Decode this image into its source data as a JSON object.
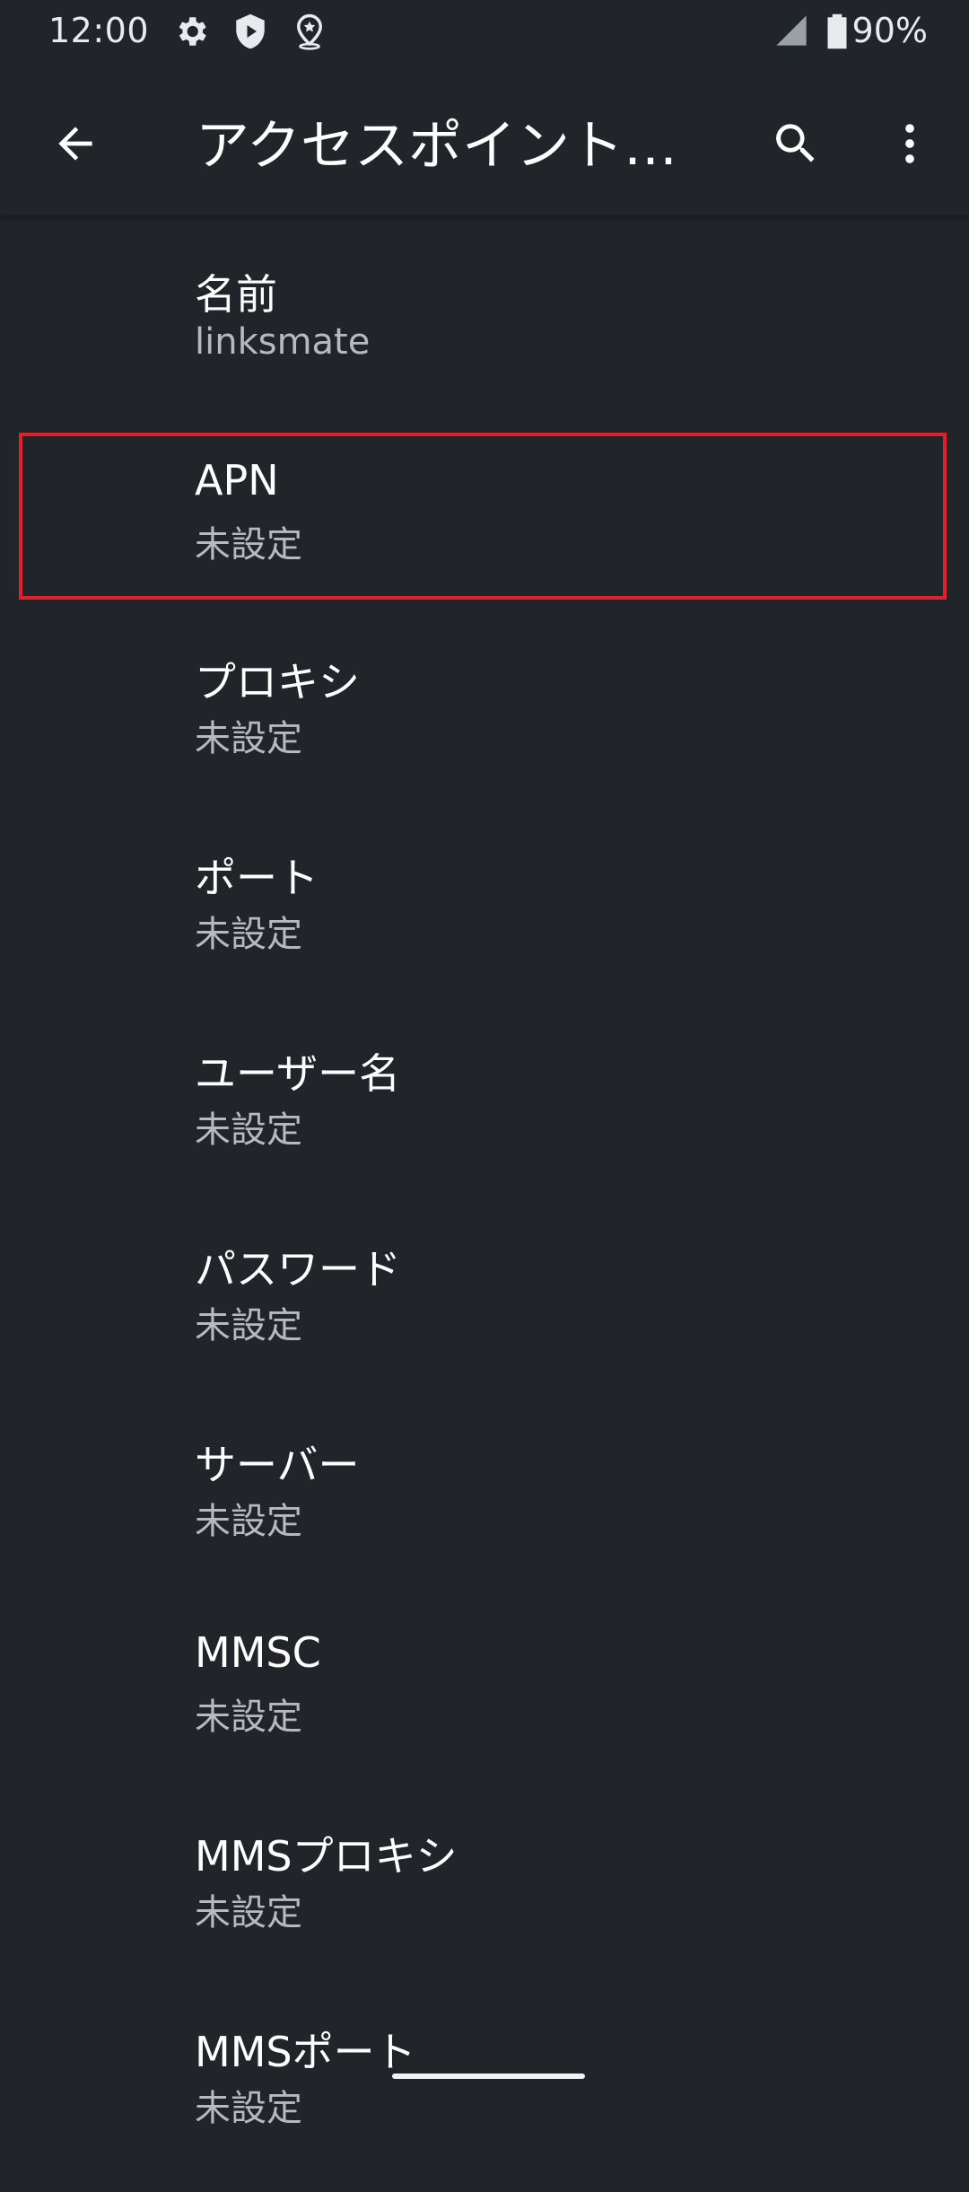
{
  "status_bar": {
    "time": "12:00",
    "battery_percent": "90%",
    "icons": [
      "gear-icon",
      "shield-play-icon",
      "location-pin-icon",
      "signal-icon",
      "battery-icon"
    ]
  },
  "app_bar": {
    "title": "アクセスポイント…",
    "icons": [
      "back-arrow-icon",
      "search-icon",
      "more-vert-icon"
    ]
  },
  "fields": [
    {
      "title": "名前",
      "summary": "linksmate"
    },
    {
      "title": "APN",
      "summary": "未設定"
    },
    {
      "title": "プロキシ",
      "summary": "未設定"
    },
    {
      "title": "ポート",
      "summary": "未設定"
    },
    {
      "title": "ユーザー名",
      "summary": "未設定"
    },
    {
      "title": "パスワード",
      "summary": "未設定"
    },
    {
      "title": "サーバー",
      "summary": "未設定"
    },
    {
      "title": "MMSC",
      "summary": "未設定"
    },
    {
      "title": "MMSプロキシ",
      "summary": "未設定"
    },
    {
      "title": "MMSポート",
      "summary": "未設定"
    }
  ],
  "colors": {
    "background": "#212529",
    "highlight": "#e0202b",
    "summary_text": "#b6b9bd"
  }
}
